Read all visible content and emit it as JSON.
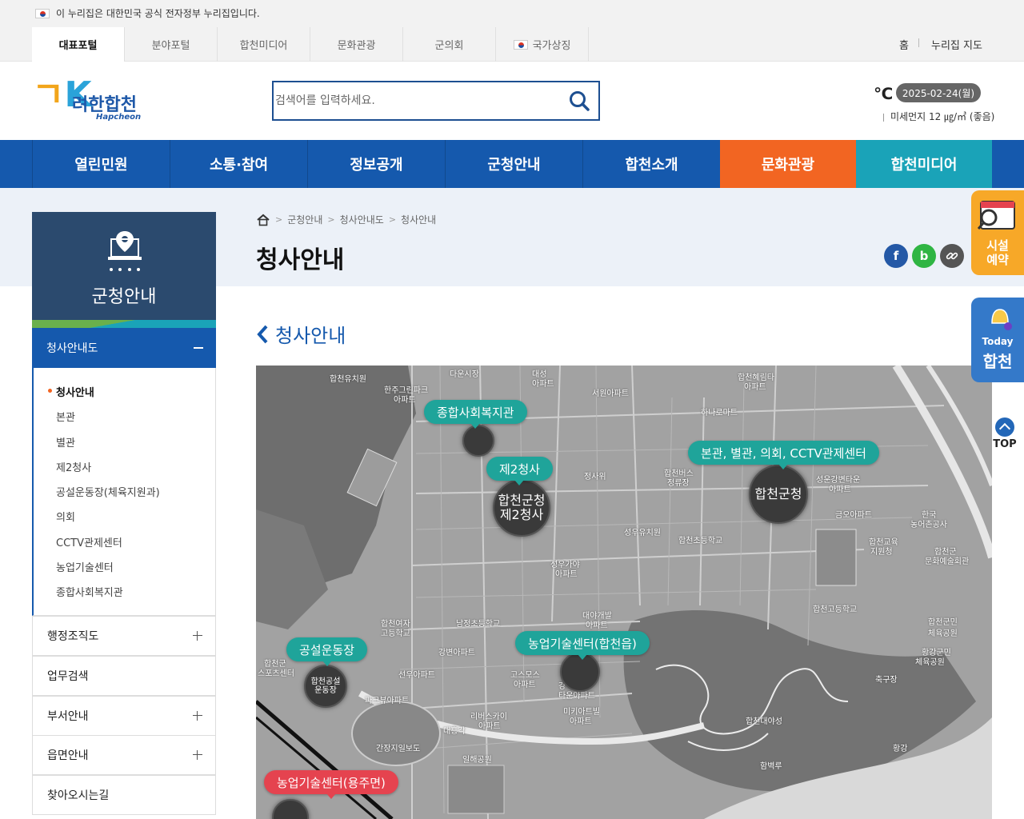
{
  "gov_banner": {
    "text": "이 누리집은 대한민국 공식 전자정부 누리집입니다."
  },
  "portal_tabs": [
    {
      "label": "대표포털"
    },
    {
      "label": "분야포털"
    },
    {
      "label": "합천미디어"
    },
    {
      "label": "문화관광"
    },
    {
      "label": "군의회"
    },
    {
      "label": "국가상징"
    }
  ],
  "util_links": {
    "home": "홈",
    "sitemap": "누리집 지도"
  },
  "logo": {
    "name": "려한합천",
    "english": "Hapcheon"
  },
  "search": {
    "placeholder": "검색어를 입력하세요."
  },
  "weather": {
    "degree": "℃",
    "date": "2025-02-24(월)",
    "dust": "미세먼지 12 ㎍/㎥ (좋음)"
  },
  "gnb": [
    {
      "label": "열린민원"
    },
    {
      "label": "소통·참여"
    },
    {
      "label": "정보공개"
    },
    {
      "label": "군청안내"
    },
    {
      "label": "합천소개"
    },
    {
      "label": "문화관광"
    },
    {
      "label": "합천미디어"
    }
  ],
  "sidebar": {
    "title": "군청안내",
    "active_group": "청사안내도",
    "sub_items": [
      {
        "label": "청사안내"
      },
      {
        "label": "본관"
      },
      {
        "label": "별관"
      },
      {
        "label": "제2청사"
      },
      {
        "label": "공설운동장(체육지원과)"
      },
      {
        "label": "의회"
      },
      {
        "label": "CCTV관제센터"
      },
      {
        "label": "농업기술센터"
      },
      {
        "label": "종합사회복지관"
      }
    ],
    "menus": [
      {
        "label": "행정조직도"
      },
      {
        "label": "업무검색"
      },
      {
        "label": "부서안내"
      },
      {
        "label": "읍면안내"
      },
      {
        "label": "찾아오시는길"
      }
    ]
  },
  "breadcrumb": [
    "군청안내",
    "청사안내도",
    "청사안내"
  ],
  "page_title": "청사안내",
  "section_title": "청사안내",
  "share": {
    "facebook": "f",
    "blog": "b"
  },
  "map": {
    "pins": [
      {
        "label": "종합사회복지관"
      },
      {
        "label": "제2청사"
      },
      {
        "label": "본관, 별관, 의회, CCTV관제센터"
      },
      {
        "label": "공설운동장"
      },
      {
        "label": "농업기술센터(합천읍)"
      },
      {
        "label": "농업기술센터(용주면)"
      }
    ],
    "circles": [
      {
        "line1": "합천군청",
        "line2": "제2청사"
      },
      {
        "line1": "합천군청",
        "line2": ""
      },
      {
        "line1": "합천공설",
        "line2": "운동장"
      }
    ],
    "labels": [
      "합천유치원",
      "다운시장",
      "한주그린파크",
      "아파트",
      "대성",
      "아파트",
      "서원아파트",
      "합천혜림타",
      "아파트",
      "하나로마트",
      "정사위",
      "합천버스",
      "정류장",
      "성운강변타운",
      "아파트",
      "금오아파트",
      "한국",
      "농어촌공사",
      "합천교육",
      "지원청",
      "합천군",
      "문화예술회관",
      "성우유치원",
      "합천초등학교",
      "성우가야",
      "아파트",
      "대야개발",
      "아파트",
      "합천고등학교",
      "합천군민",
      "체육공원",
      "합천여자",
      "고등학교",
      "남정초등학교",
      "강변아파트",
      "합천군",
      "스포츠센터",
      "선우아파트",
      "고스모스",
      "아파트",
      "강하이",
      "타운아파트",
      "합천대야성",
      "미키아트빌",
      "아파트",
      "리버스카이",
      "아파트",
      "파크뷰아파트",
      "대흥각",
      "간장지일보도",
      "일해공원",
      "함벽루",
      "황강",
      "황강군민",
      "체육공원",
      "축구장"
    ]
  },
  "floating": {
    "reserve_line1": "시설",
    "reserve_line2": "예약",
    "today_line1": "Today",
    "today_line2": "합천",
    "top": "TOP"
  },
  "colors": {
    "primary": "#1559ad",
    "orange": "#f26522",
    "teal": "#1aa3b8",
    "pin": "#1fa49a",
    "pin_red": "#e5434f"
  }
}
